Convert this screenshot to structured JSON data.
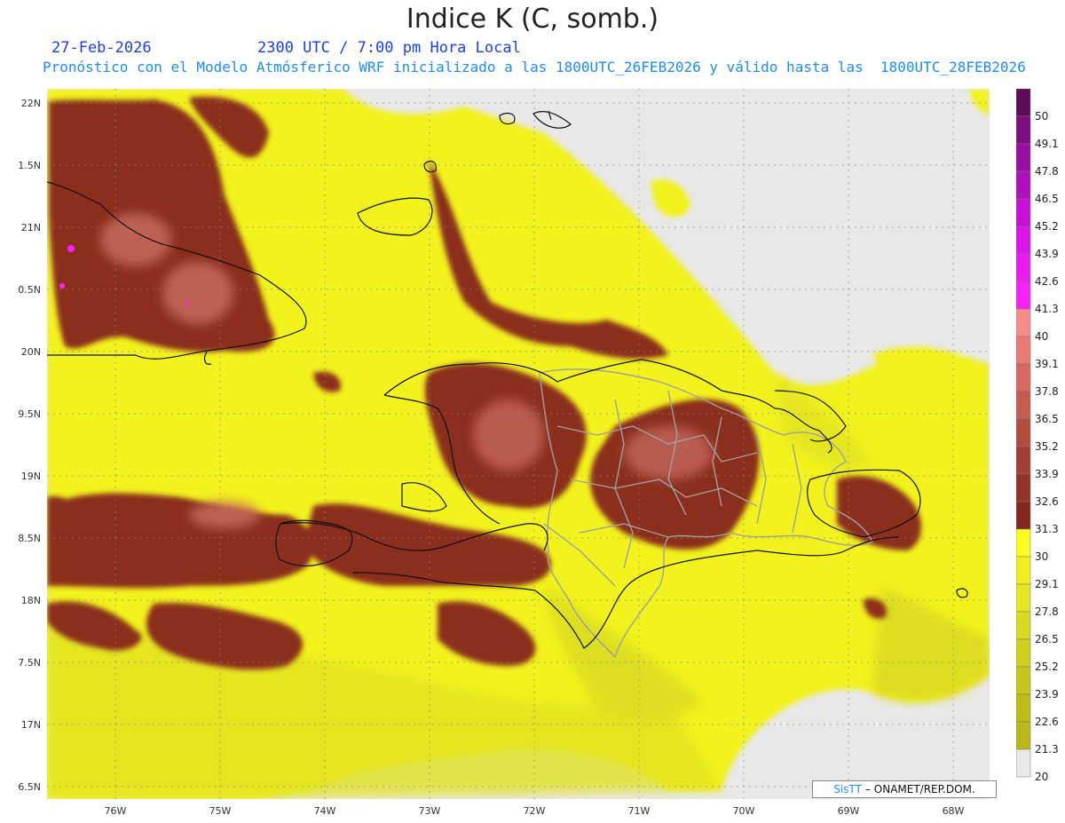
{
  "header": {
    "title": "Indice K (C, somb.)",
    "date": "27-Feb-2026",
    "time": "2300 UTC / 7:00 pm Hora Local",
    "subtitle": "Pronóstico con el Modelo Atmósferico WRF inicializado a las 1800UTC_26FEB2026 y válido hasta las  1800UTC_28FEB2026"
  },
  "axes": {
    "lat_labels": [
      "22N",
      "1.5N",
      "21N",
      "0.5N",
      "20N",
      "9.5N",
      "19N",
      "8.5N",
      "18N",
      "7.5N",
      "17N",
      "6.5N"
    ],
    "lon_labels": [
      "76W",
      "75W",
      "74W",
      "73W",
      "72W",
      "71W",
      "70W",
      "69W",
      "68W"
    ]
  },
  "colorbar": {
    "labels": [
      "50",
      "49.1",
      "47.8",
      "46.5",
      "45.2",
      "43.9",
      "42.6",
      "41.3",
      "40",
      "39.1",
      "37.8",
      "36.5",
      "35.2",
      "33.9",
      "32.6",
      "31.3",
      "30",
      "29.1",
      "27.8",
      "26.5",
      "25.2",
      "23.9",
      "22.6",
      "21.3",
      "20"
    ],
    "colors": [
      "#5e0a5a",
      "#7d0c7e",
      "#970fa0",
      "#b00fc0",
      "#c810d8",
      "#dc14e8",
      "#ec1cf0",
      "#f820f8",
      "#f98a8a",
      "#ea7874",
      "#d96860",
      "#c75a4e",
      "#b54a3e",
      "#a33e32",
      "#923326",
      "#82281c",
      "#faff20",
      "#f0f01e",
      "#e4e620",
      "#d8dc20",
      "#ccd21c",
      "#c4c81a",
      "#bcbe18",
      "#b8b818",
      "#e8e8e8"
    ]
  },
  "credit": {
    "brand": "SisTT",
    "org": "– ONAMET/REP.DOM."
  },
  "palette": {
    "ocean_no_data": "#e8e8e8",
    "low_k": "#f2f21e",
    "mid_k": "#e0e020",
    "high_k": "#8b2e1e",
    "very_high_k": "#c26458",
    "extreme_k": "#ff20ff"
  }
}
